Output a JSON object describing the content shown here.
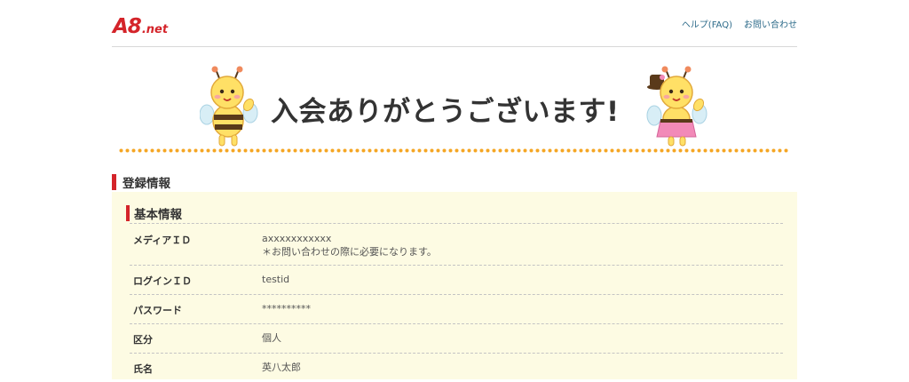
{
  "header": {
    "logo_main": "A8",
    "logo_suffix": ".net",
    "help_link": "ヘルプ(FAQ)",
    "contact_link": "お問い合わせ"
  },
  "banner": {
    "title": "入会ありがとうございます!"
  },
  "section": {
    "title": "登録情報"
  },
  "basic_info": {
    "title": "基本情報",
    "rows": [
      {
        "label": "メディアＩＤ",
        "value": "axxxxxxxxxxx",
        "note": "＊お問い合わせの際に必要になります。"
      },
      {
        "label": "ログインＩＤ",
        "value": "testid"
      },
      {
        "label": "パスワード",
        "value": "**********"
      },
      {
        "label": "区分",
        "value": "個人"
      },
      {
        "label": "氏名",
        "value": "英八太郎"
      }
    ]
  },
  "colors": {
    "accent_red": "#d4242a",
    "panel_bg": "#fdfbe3",
    "dots_orange": "#f5a623",
    "link_blue": "#2d6b8a"
  }
}
